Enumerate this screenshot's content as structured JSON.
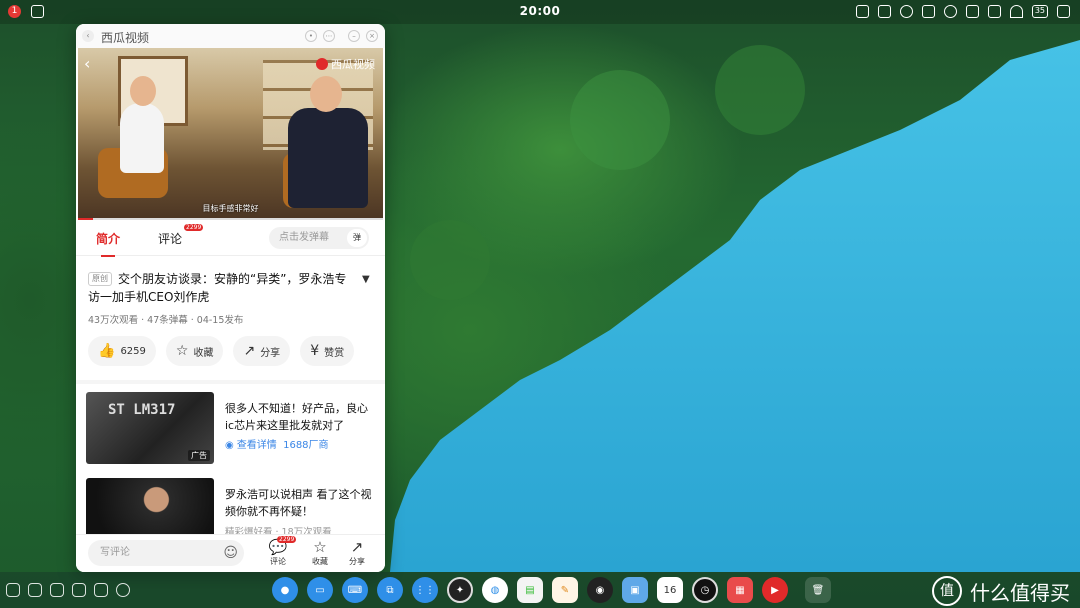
{
  "system": {
    "clock": "20:00",
    "notification_badge": "1",
    "battery": "35"
  },
  "window": {
    "title": "西瓜视频"
  },
  "video": {
    "logo_text": "西瓜视频",
    "subtitle": "目标手感非常好",
    "progress": 0.05
  },
  "tabs": {
    "intro": "简介",
    "comments": "评论",
    "comments_count": "2299",
    "danmu_placeholder": "点击发弹幕",
    "danmu_icon": "弹"
  },
  "detail": {
    "original_tag": "原创",
    "title": "交个朋友访谈录：安静的“异类”，罗永浩专访一加手机CEO刘作虎",
    "meta": "43万次观看 · 47条弹幕 · 04-15发布"
  },
  "actions": [
    {
      "icon": "like-icon",
      "label": "6259"
    },
    {
      "icon": "star-icon",
      "label": "收藏"
    },
    {
      "icon": "share-icon",
      "label": "分享"
    },
    {
      "icon": "reward-icon",
      "label": "赞赏"
    }
  ],
  "recommendations": {
    "ad": {
      "title": "很多人不知道！好产品，良心ic芯片来这里批发就对了",
      "link_label": "查看详情",
      "source": "1688厂商",
      "ad_tag": "广告",
      "thumb_text": "ST LM317"
    },
    "video2": {
      "title": "罗永浩可以说相声 看了这个视频你就不再怀疑！",
      "meta": "精彩爆好看 · 18万次观看"
    }
  },
  "bottombar": {
    "comment_placeholder": "写评论",
    "comment_label": "评论",
    "comment_count": "2299",
    "favorite_label": "收藏",
    "share_label": "分享"
  },
  "watermark": {
    "text": "什么值得买",
    "icon": "值"
  },
  "colors": {
    "accent": "#e02a2a",
    "link": "#3a86e6",
    "lake": "#3fb6dc"
  }
}
